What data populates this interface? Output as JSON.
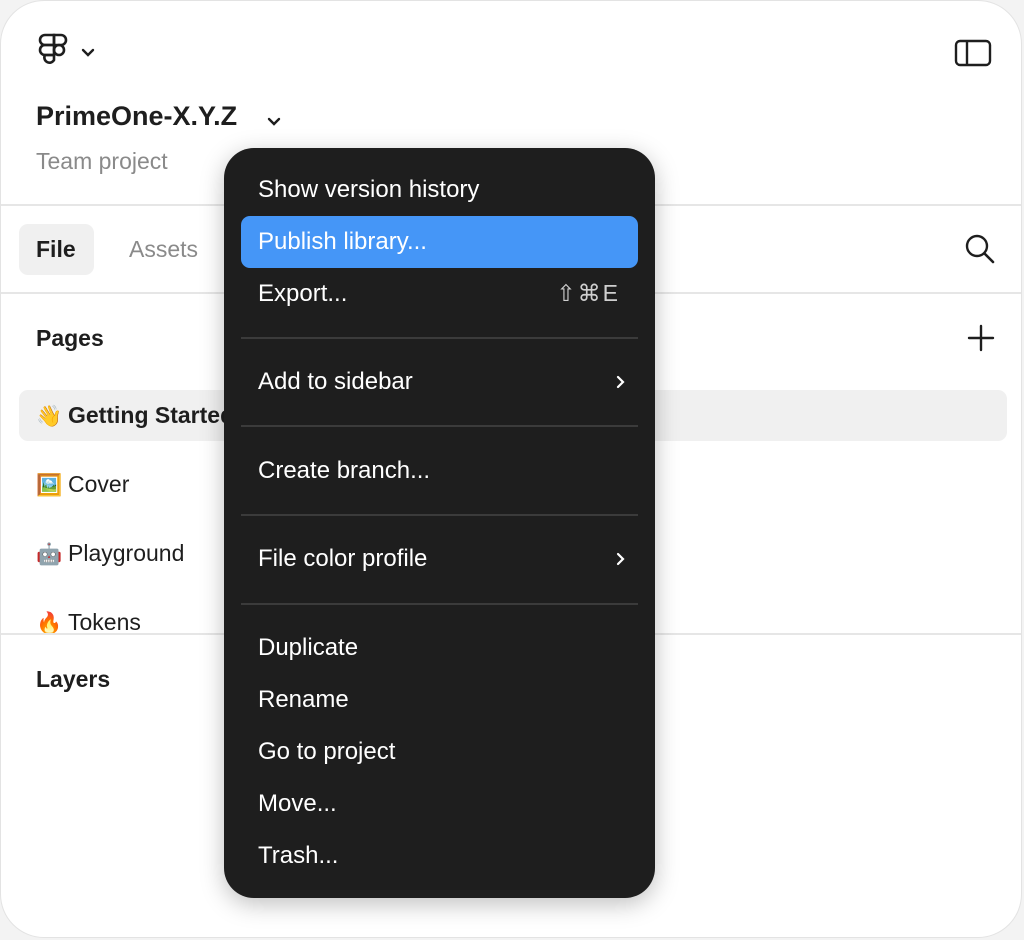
{
  "header": {
    "project_name": "PrimeOne-X.Y.Z",
    "project_type": "Team project"
  },
  "tabs": [
    {
      "label": "File",
      "active": true
    },
    {
      "label": "Assets",
      "active": false
    }
  ],
  "pages": {
    "title": "Pages",
    "items": [
      {
        "emoji": "👋",
        "label": "Getting Started",
        "active": true
      },
      {
        "emoji": "🖼️",
        "label": "Cover",
        "active": false
      },
      {
        "emoji": "🤖",
        "label": "Playground",
        "active": false
      },
      {
        "emoji": "🔥",
        "label": "Tokens",
        "active": false
      }
    ]
  },
  "layers": {
    "title": "Layers"
  },
  "menu": {
    "items": [
      {
        "label": "Show version history"
      },
      {
        "label": "Publish library...",
        "highlighted": true
      },
      {
        "label": "Export...",
        "shortcut": "⇧⌘E"
      },
      {
        "label": "Add to sidebar",
        "submenu": true
      },
      {
        "label": "Create branch..."
      },
      {
        "label": "File color profile",
        "submenu": true
      },
      {
        "label": "Duplicate"
      },
      {
        "label": "Rename"
      },
      {
        "label": "Go to project"
      },
      {
        "label": "Move..."
      },
      {
        "label": "Trash..."
      }
    ]
  },
  "colors": {
    "menu_bg": "#1e1e1e",
    "highlight": "#4596f7",
    "text_primary": "#1e1e1e",
    "text_secondary": "#8a8a8a"
  },
  "icons": [
    "figma-logo-icon",
    "chevron-down-icon",
    "sidebar-toggle-icon",
    "search-icon",
    "plus-icon",
    "chevron-right-icon"
  ]
}
